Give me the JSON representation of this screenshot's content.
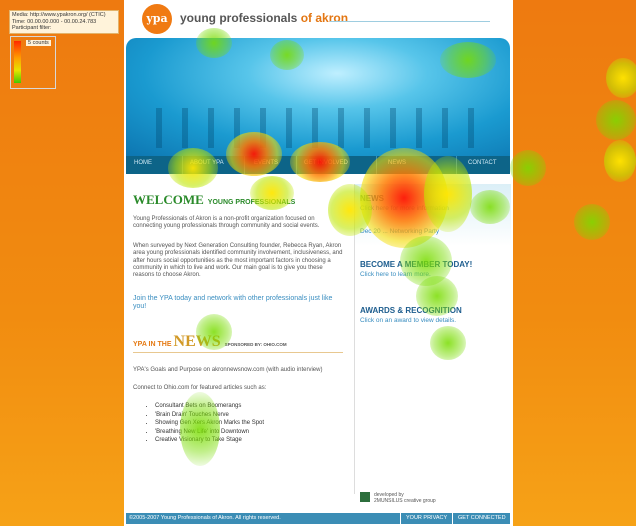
{
  "overlay": {
    "media": "Media: http://www.ypakron.org/ (CTIC)",
    "time": "Time: 00.00.00.000 - 00.00.24.783",
    "participant": "Participant filter:",
    "legend_count": "5 counts"
  },
  "site": {
    "logo_mark": "ypa",
    "logo_prefix": "young professionals",
    "logo_suffix": "of akron"
  },
  "nav": [
    "HOME",
    "ABOUT YPA",
    "EVENTS",
    "GET INVOLVED",
    "NEWS",
    "CONTACT"
  ],
  "welcome": {
    "title": "WELCOME",
    "subtitle": "YOUNG PROFESSIONALS",
    "p1": "Young Professionals of Akron is a non-profit organization focused on connecting young professionals through community and social events.",
    "p2": "When surveyed by Next Generation Consulting founder, Rebecca Ryan, Akron area young professionals identified community involvement, inclusiveness, and after hours social opportunities as the most important factors in choosing a community in which to live and work. Our main goal is to give you these reasons to choose Akron.",
    "cta": "Join the YPA today and network with other professionals just like you!"
  },
  "news": {
    "ypa_in_the": "YPA IN THE",
    "news": "NEWS",
    "sponsored": "SPONSORED BY: OHIO.COM",
    "item1": "YPA's Goals and Purpose on akronnewsnow.com (with audio interview)",
    "intro": "Connect to Ohio.com for featured articles such as:",
    "articles": [
      "Consultant Bets on Boomerangs",
      "'Brain Drain' Touches Nerve",
      "Showing Gen Xers Akron Marks the Spot",
      "'Breathing New Life' into Downtown",
      "Creative Visionary to Take Stage"
    ]
  },
  "sidebar": {
    "news_head": "NEWS",
    "news_line1": "Click here for more information",
    "news_line2": "Dec 20 ... Networking Party",
    "member_head": "BECOME A MEMBER TODAY!",
    "member_sub": "Click here to learn more.",
    "awards_head": "AWARDS & RECOGNITION",
    "awards_sub": "Click on an award to view details.",
    "developed_by": "developed by",
    "developer": "2MUNSILUS creative group"
  },
  "footer": {
    "copyright": "©2005-2007 Young Professionals of Akron. All rights reserved.",
    "privacy": "YOUR PRIVACY",
    "connected": "GET CONNECTED"
  }
}
